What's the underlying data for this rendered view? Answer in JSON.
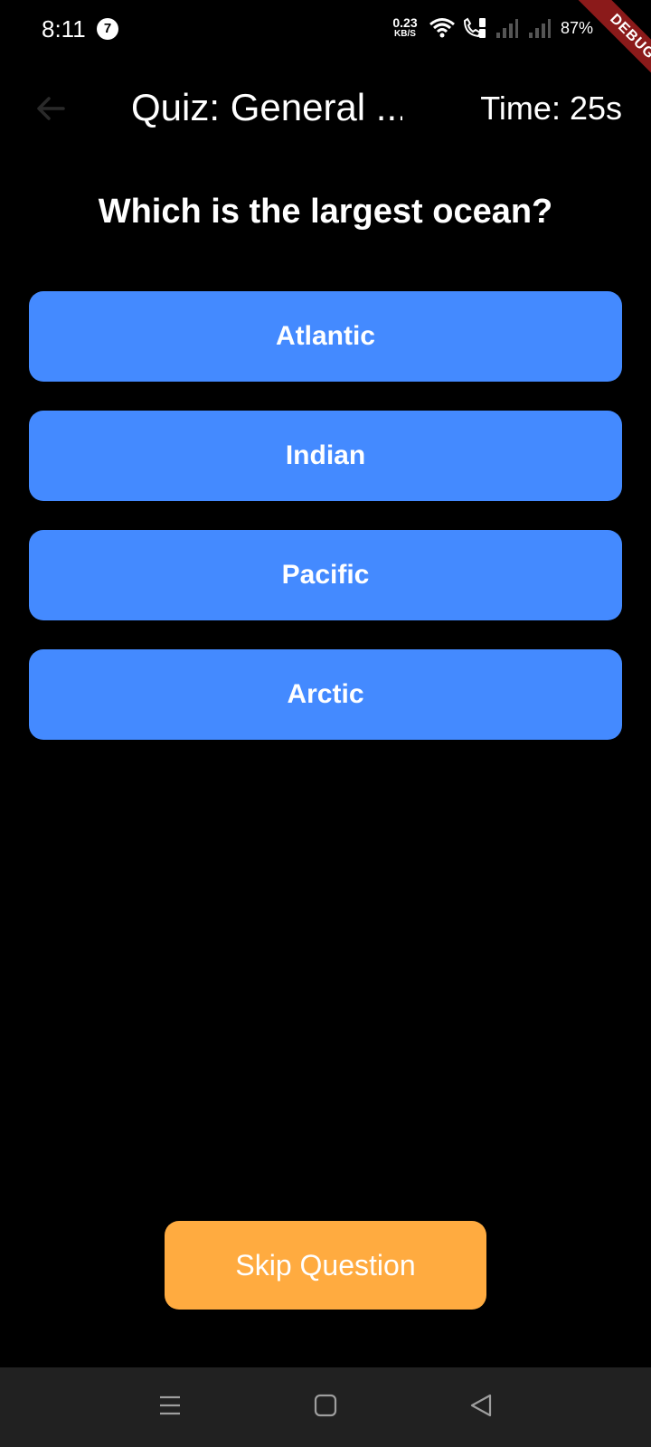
{
  "status_bar": {
    "time": "8:11",
    "notification_count": "7",
    "net_speed_value": "0.23",
    "net_speed_unit": "KB/S",
    "battery": "87%",
    "icons": [
      "wifi-icon",
      "call-icon",
      "signal-icon",
      "signal-icon",
      "battery-icon"
    ]
  },
  "debug_banner": {
    "label": "DEBUG"
  },
  "app_bar": {
    "title": "Quiz: General ...",
    "timer": "Time: 25s",
    "back_icon": "arrow-back-icon"
  },
  "question": {
    "text": "Which is the largest ocean?"
  },
  "answers": [
    {
      "label": "Atlantic"
    },
    {
      "label": "Indian"
    },
    {
      "label": "Pacific"
    },
    {
      "label": "Arctic"
    }
  ],
  "skip": {
    "label": "Skip Question"
  },
  "nav_bar": {
    "icons": [
      "menu-icon",
      "home-icon",
      "back-icon"
    ]
  },
  "colors": {
    "background": "#000000",
    "answer_button": "#448aff",
    "skip_button": "#ffab40",
    "debug_banner": "#8b1a1a",
    "nav_bar": "#212121"
  }
}
